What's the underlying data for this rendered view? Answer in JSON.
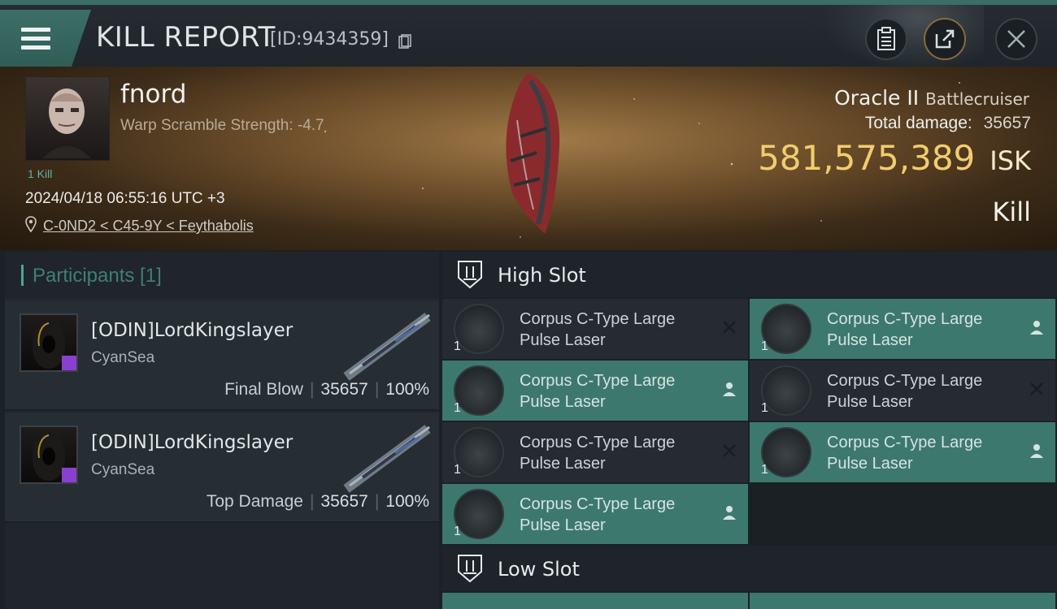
{
  "header": {
    "title": "KILL REPORT",
    "report_id": "[ID:9434359]"
  },
  "victim": {
    "name": "fnord",
    "warp_scramble": "Warp Scramble Strength: -4.7",
    "kill_count": "1 Kill",
    "timestamp": "2024/04/18 06:55:16 UTC +3",
    "location": "C-0ND2 < C45-9Y < Feythabolis",
    "ship_name": "Oracle II",
    "ship_class": "Battlecruiser",
    "total_damage_label": "Total damage:",
    "total_damage": "35657",
    "isk_value": "581,575,389",
    "isk_unit": "ISK",
    "result": "Kill"
  },
  "participants": {
    "title": "Participants [1]",
    "rows": [
      {
        "name": "[ODIN]LordKingslayer",
        "corp": "CyanSea",
        "role": "Final Blow",
        "damage": "35657",
        "percent": "100%"
      },
      {
        "name": "[ODIN]LordKingslayer",
        "corp": "CyanSea",
        "role": "Top Damage",
        "damage": "35657",
        "percent": "100%"
      }
    ]
  },
  "slots": {
    "high_title": "High Slot",
    "low_title": "Low Slot",
    "high_items": [
      {
        "line1": "Corpus C-Type Large",
        "line2": "Pulse Laser",
        "qty": "1",
        "status": "destroyed"
      },
      {
        "line1": "Corpus C-Type Large",
        "line2": "Pulse Laser",
        "qty": "1",
        "status": "dropped"
      },
      {
        "line1": "Corpus C-Type Large",
        "line2": "Pulse Laser",
        "qty": "1",
        "status": "dropped"
      },
      {
        "line1": "Corpus C-Type Large",
        "line2": "Pulse Laser",
        "qty": "1",
        "status": "destroyed"
      },
      {
        "line1": "Corpus C-Type Large",
        "line2": "Pulse Laser",
        "qty": "1",
        "status": "destroyed"
      },
      {
        "line1": "Corpus C-Type Large",
        "line2": "Pulse Laser",
        "qty": "1",
        "status": "dropped"
      },
      {
        "line1": "Corpus C-Type Large",
        "line2": "Pulse Laser",
        "qty": "1",
        "status": "dropped"
      }
    ]
  },
  "colors": {
    "accent_teal": "#3d786f",
    "isk_gold": "#f1cd6e",
    "header_teal": "#3a6e66"
  },
  "icons": {
    "menu": "hamburger-menu-icon",
    "copy": "copy-icon",
    "clipboard": "clipboard-icon",
    "share": "share-icon",
    "close": "close-icon",
    "location": "location-pin-icon",
    "slot": "slot-icon",
    "destroyed": "x-icon",
    "dropped": "person-icon"
  }
}
